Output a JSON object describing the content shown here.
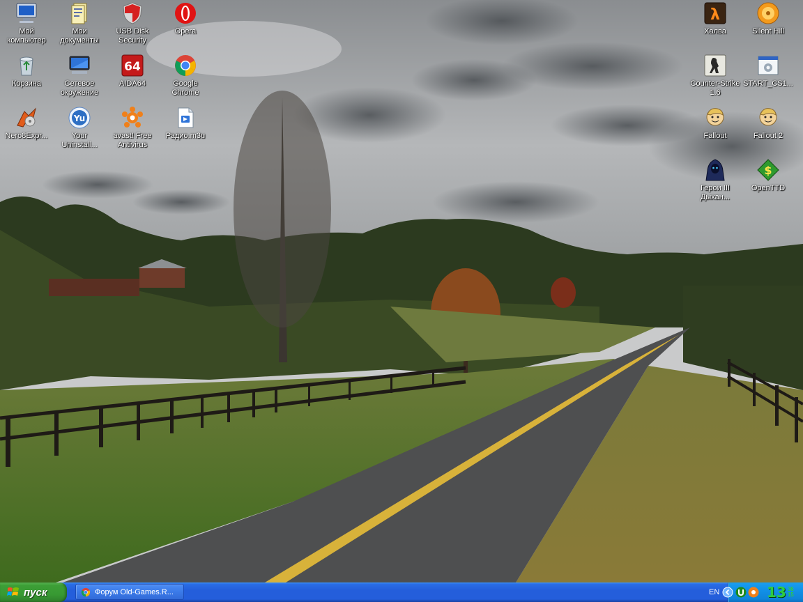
{
  "desktop": {
    "icons": [
      {
        "label": "Мой компьютер",
        "icon": "my-computer-icon"
      },
      {
        "label": "Мои документы",
        "icon": "my-documents-icon"
      },
      {
        "label": "USB Disk Security",
        "icon": "usb-disk-security-icon"
      },
      {
        "label": "Opera",
        "icon": "opera-icon"
      },
      {
        "label": "Корзина",
        "icon": "recycle-bin-icon"
      },
      {
        "label": "Сетевое окружение",
        "icon": "network-places-icon"
      },
      {
        "label": "AIDA64",
        "icon": "aida64-icon"
      },
      {
        "label": "Google Chrome",
        "icon": "chrome-icon"
      },
      {
        "label": "Nero8Expr...",
        "icon": "nero-icon"
      },
      {
        "label": "Your Uninstall...",
        "icon": "your-uninstaller-icon"
      },
      {
        "label": "avast! Free Antivirus",
        "icon": "avast-icon"
      },
      {
        "label": "Радио.m3u",
        "icon": "playlist-file-icon"
      },
      {
        "label": "Халва",
        "icon": "half-life-icon"
      },
      {
        "label": "Silent Hill",
        "icon": "silent-hill-icon"
      },
      {
        "label": "Counter-Strike 1.6",
        "icon": "counter-strike-icon"
      },
      {
        "label": "START_CS1...",
        "icon": "settings-window-icon"
      },
      {
        "label": "Fallout",
        "icon": "fallout-icon"
      },
      {
        "label": "Fallout 2",
        "icon": "fallout2-icon"
      },
      {
        "label": "Герои III Дыхан...",
        "icon": "heroes3-icon"
      },
      {
        "label": "OpenTTD",
        "icon": "openttd-icon"
      }
    ]
  },
  "taskbar": {
    "start_label": "пуск",
    "tasks": [
      {
        "label": "Форум Old-Games.R...",
        "icon": "chrome-icon"
      }
    ],
    "tray": {
      "language": "EN",
      "icons": [
        "chevron-left-icon",
        "utorrent-icon",
        "avast-tray-icon"
      ],
      "clock_hour": "13",
      "clock_minute_top": "36",
      "clock_minute_bottom": "15"
    }
  },
  "colors": {
    "taskbar_blue": "#245edb",
    "start_green": "#389a33",
    "clock_green": "#2ecc40"
  }
}
